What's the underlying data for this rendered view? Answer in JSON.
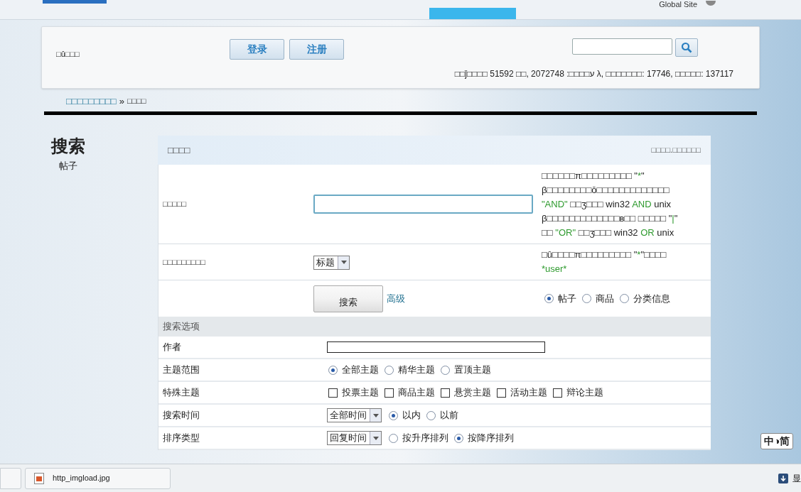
{
  "nav": {
    "global_site": "Global Site"
  },
  "header": {
    "greeting": "□û□□□",
    "buttons": [
      "登录",
      "注册"
    ],
    "stats": "□□ǰ□□□□ 51592 □□, ע□□□□: 2072748 λ, □□□□□□□: 17746, □□□□□: 137117"
  },
  "breadcrumb": {
    "link": "□□□□□□□□□",
    "separator": "»",
    "current": "□□□□"
  },
  "sidebar": {
    "title": "搜索",
    "subtitle": "帖子"
  },
  "panel": {
    "title": "□□□□",
    "right": "□□□□.□□□□□□",
    "keyword_row": {
      "label": "□□□□□",
      "hint": [
        [
          {
            "text": "□□□□□□π□□□□□□□□□ \"",
            "highlight": false
          },
          {
            "text": "*",
            "highlight": true
          },
          {
            "text": "\"",
            "highlight": false
          }
        ],
        [
          {
            "text": "β□□□□□□□□ō□□□□□□□□□□□□□",
            "highlight": false
          }
        ],
        [
          {
            "text": "\"AND\"",
            "highlight": true
          },
          {
            "text": " □□ʒ□□□ win32 ",
            "highlight": false
          },
          {
            "text": "AND",
            "highlight": true
          },
          {
            "text": " unix",
            "highlight": false
          }
        ],
        [
          {
            "text": "β□□□□□□□□□□□□□в□□  □□□□□ \"",
            "highlight": false
          },
          {
            "text": "|",
            "highlight": true
          },
          {
            "text": "\"",
            "highlight": false
          }
        ],
        [
          {
            "text": "□□ ",
            "highlight": false
          },
          {
            "text": "\"OR\"",
            "highlight": true
          },
          {
            "text": " □□ʒ□□□ win32 ",
            "highlight": false
          },
          {
            "text": "OR",
            "highlight": true
          },
          {
            "text": " unix",
            "highlight": false
          }
        ]
      ]
    },
    "scope_row": {
      "label": "□□□□□□□□□",
      "select": "标题",
      "hint": [
        [
          {
            "text": "□û□□□□π□□□□□□□□□ \"",
            "highlight": false
          },
          {
            "text": "*",
            "highlight": true
          },
          {
            "text": "\"□□□□",
            "highlight": false
          }
        ],
        [
          {
            "text": "*user*",
            "highlight": true
          }
        ]
      ]
    },
    "action_row": {
      "search_button": "搜索",
      "advanced_link": "高级",
      "types": [
        {
          "label": "帖子",
          "selected": true
        },
        {
          "label": "商品",
          "selected": false
        },
        {
          "label": "分类信息",
          "selected": false
        }
      ]
    }
  },
  "options": {
    "title": "搜索选项",
    "rows": [
      {
        "kind": "text",
        "label": "作者"
      },
      {
        "kind": "radio",
        "label": "主题范围",
        "options": [
          {
            "label": "全部主题",
            "selected": true
          },
          {
            "label": "精华主题",
            "selected": false
          },
          {
            "label": "置顶主题",
            "selected": false
          }
        ]
      },
      {
        "kind": "check",
        "label": "特殊主题",
        "options": [
          {
            "label": "投票主题",
            "checked": false
          },
          {
            "label": "商品主题",
            "checked": false
          },
          {
            "label": "悬赏主题",
            "checked": false
          },
          {
            "label": "活动主题",
            "checked": false
          },
          {
            "label": "辩论主题",
            "checked": false
          }
        ]
      },
      {
        "kind": "select",
        "label": "搜索时间",
        "select": "全部时间",
        "options": [
          {
            "label": "以内",
            "selected": true
          },
          {
            "label": "以前",
            "selected": false
          }
        ]
      },
      {
        "kind": "select",
        "label": "排序类型",
        "select": "回复时间",
        "options": [
          {
            "label": "按升序排列",
            "selected": false
          },
          {
            "label": "按降序排列",
            "selected": true
          }
        ]
      }
    ]
  },
  "language_badge": "中◑简",
  "downloads": {
    "file": "http_imgload.jpg",
    "show_all": "显"
  }
}
